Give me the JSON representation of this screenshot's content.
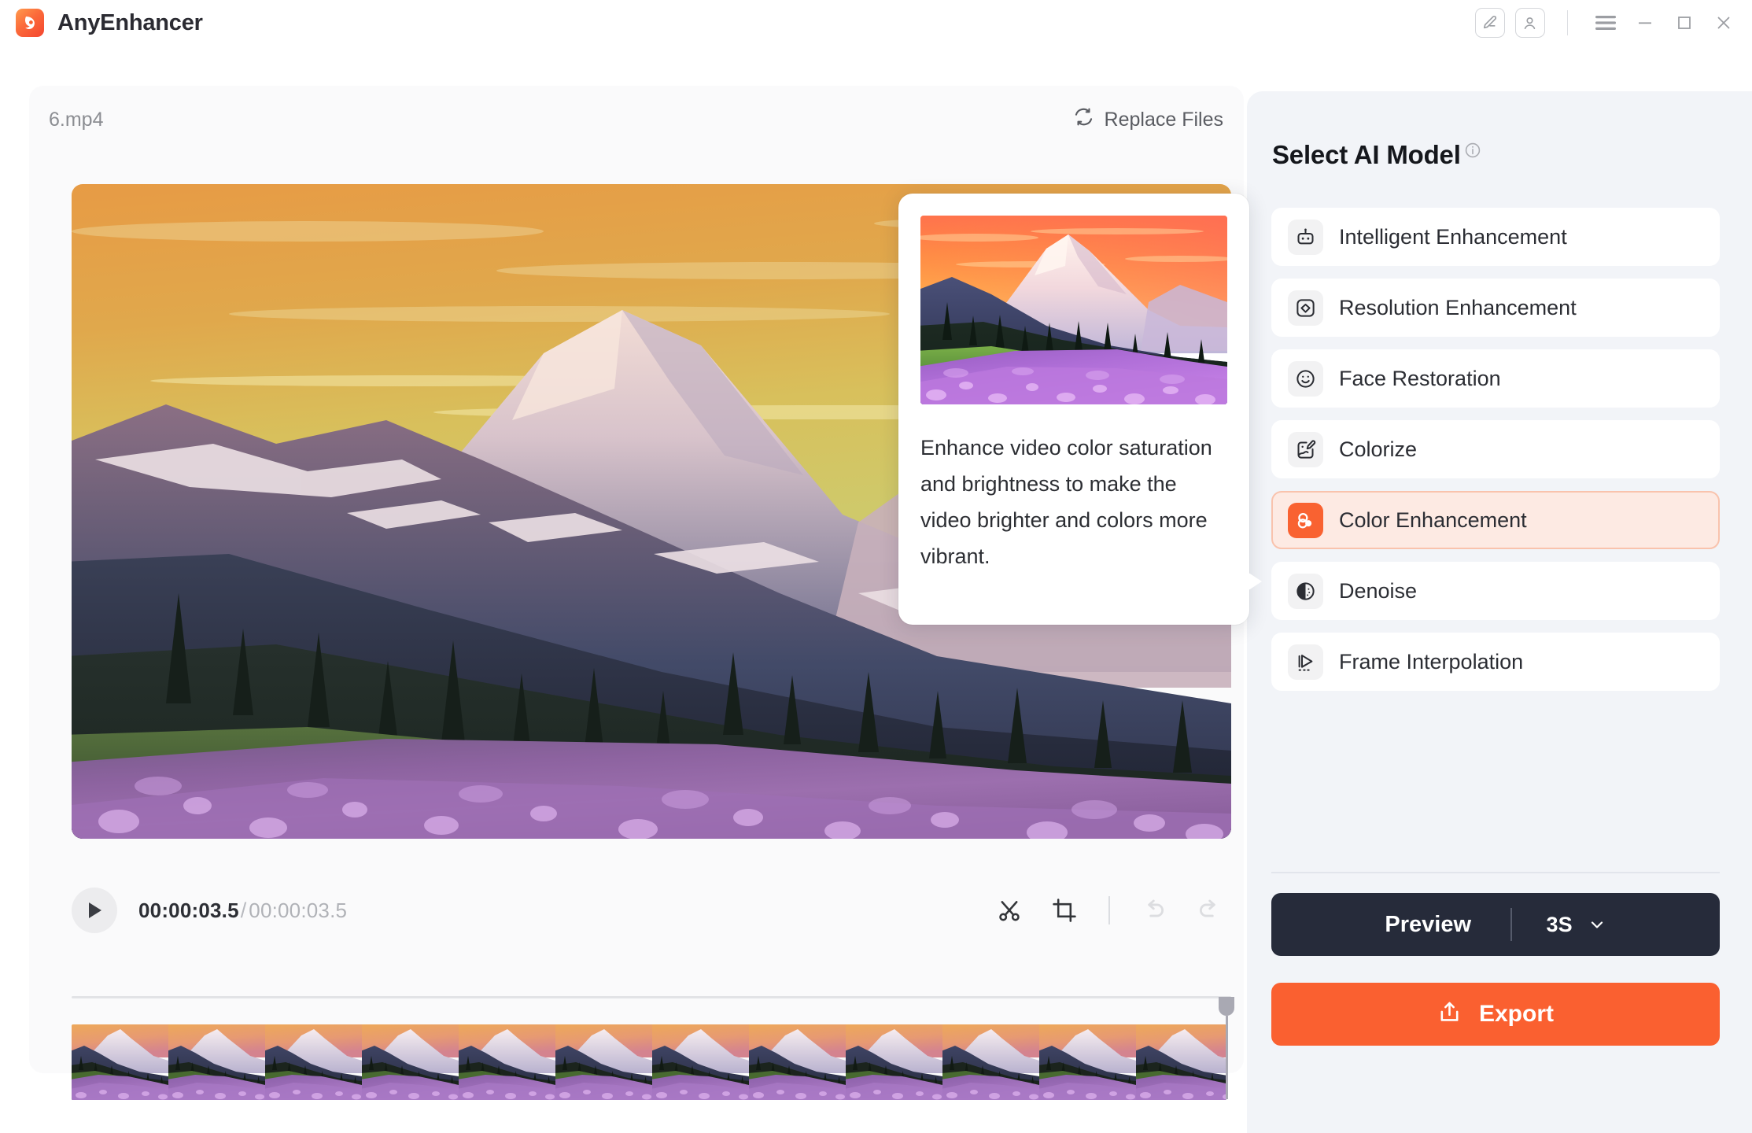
{
  "app": {
    "name": "AnyEnhancer",
    "logo_icon": "app-logo-icon"
  },
  "titlebar": {
    "edit_icon": "pencil-edit-icon",
    "account_icon": "user-account-icon",
    "menu_icon": "hamburger-menu-icon",
    "minimize_icon": "minimize-icon",
    "maximize_icon": "maximize-icon",
    "close_icon": "close-icon"
  },
  "editor": {
    "file_name": "6.mp4",
    "replace_label": "Replace Files",
    "replace_icon": "refresh-icon",
    "play_icon": "play-icon",
    "current_time": "00:00:03.5",
    "time_separator": "/",
    "total_time": "00:00:03.5",
    "tools": [
      {
        "name": "cut-icon",
        "label": "Cut",
        "enabled": true
      },
      {
        "name": "crop-icon",
        "label": "Crop",
        "enabled": true
      },
      {
        "name": "undo-icon",
        "label": "Undo",
        "enabled": false
      },
      {
        "name": "redo-icon",
        "label": "Redo",
        "enabled": false
      }
    ],
    "timeline_frame_count": 12
  },
  "tooltip": {
    "description": "Enhance video color saturation and brightness to make the video brighter and colors more vibrant.",
    "preview_image": "color-enhanced-mountain-lavender-thumbnail"
  },
  "panel": {
    "title": "Select AI Model",
    "info_icon": "info-circle-icon",
    "models": [
      {
        "label": "Intelligent Enhancement",
        "icon": "robot-icon",
        "selected": false
      },
      {
        "label": "Resolution Enhancement",
        "icon": "resolution-diamond-icon",
        "selected": false
      },
      {
        "label": "Face Restoration",
        "icon": "smiley-face-icon",
        "selected": false
      },
      {
        "label": "Colorize",
        "icon": "colorize-brush-icon",
        "selected": false
      },
      {
        "label": "Color Enhancement",
        "icon": "color-circles-icon",
        "selected": true
      },
      {
        "label": "Denoise",
        "icon": "denoise-contrast-icon",
        "selected": false
      },
      {
        "label": "Frame Interpolation",
        "icon": "frame-play-icon",
        "selected": false
      }
    ],
    "preview_label": "Preview",
    "preview_duration": "3S",
    "preview_chevron_icon": "chevron-down-icon",
    "export_label": "Export",
    "export_icon": "export-upload-icon"
  },
  "colors": {
    "accent_orange": "#fa6030",
    "selected_bg": "#fdeae3",
    "selected_border": "#f9c3ad",
    "dark_button": "#262b3a",
    "panel_bg": "#f2f4f8",
    "card_bg": "#fafafb"
  }
}
